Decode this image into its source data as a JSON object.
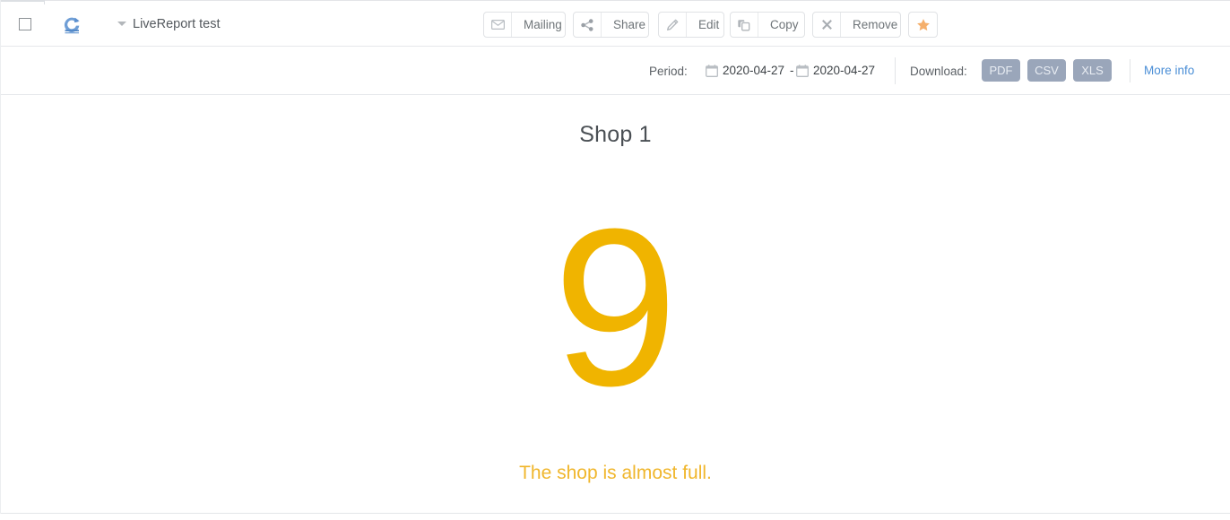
{
  "header": {
    "checkbox_checked": false,
    "report_icon": "live-report-icon",
    "caret_icon": "chevron-down-icon",
    "report_title": "LiveReport test",
    "toolbar": [
      {
        "id": "mailing",
        "label": "Mailing",
        "icon": "envelope-icon"
      },
      {
        "id": "share",
        "label": "Share",
        "icon": "share-nodes-icon"
      },
      {
        "id": "edit",
        "label": "Edit",
        "icon": "pencil-icon"
      },
      {
        "id": "copy",
        "label": "Copy",
        "icon": "copy-icon"
      },
      {
        "id": "remove",
        "label": "Remove",
        "icon": "close-x-icon"
      },
      {
        "id": "star",
        "label": "",
        "icon": "star-icon"
      }
    ]
  },
  "subheader": {
    "period_label": "Period:",
    "date_from": "2020-04-27",
    "date_separator": "-",
    "date_to": "2020-04-27",
    "calendar_icon": "calendar-icon",
    "download_label": "Download:",
    "download_buttons": [
      {
        "id": "pdf",
        "label": "PDF"
      },
      {
        "id": "csv",
        "label": "CSV"
      },
      {
        "id": "xls",
        "label": "XLS"
      }
    ],
    "more_info": "More info"
  },
  "widget": {
    "title": "Shop 1",
    "value": "9",
    "caption": "The shop is almost full."
  },
  "colors": {
    "amber": "#f0b400",
    "amber_text": "#f0b62c",
    "star": "#f5af6b",
    "download_button": "#9aa6ba",
    "link": "#4a8ed6",
    "icon_gray": "#b9bec3",
    "border": "#e6e8eb"
  }
}
